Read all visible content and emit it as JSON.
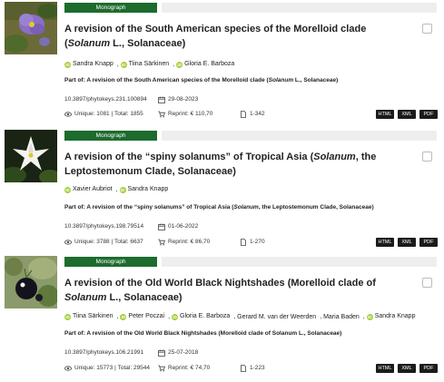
{
  "articles": [
    {
      "type_label": "Monograph",
      "title_pre": "A revision of the South American species of the Morelloid clade (",
      "title_species": "Solanum",
      "title_post": " L., Solanaceae)",
      "authors": [
        "Sandra Knapp",
        "Tiina Särkinen",
        "Gloria E. Barboza"
      ],
      "part_of_prefix": "Part of: ",
      "part_of_pre": "A revision of the South American species of the Morelloid clade (",
      "part_of_species": "Solanum",
      "part_of_post": " L., Solanaceae)",
      "doi": "10.3897/phytokeys.231.100894",
      "date": "29-08-2023",
      "unique": "Unique: 1081",
      "total": "Total: 1855",
      "reprint": "Reprint: € 110,70",
      "pages": "1-342",
      "formats": [
        "HTML",
        "XML",
        "PDF"
      ]
    },
    {
      "type_label": "Monograph",
      "title_pre": "A revision of the “spiny solanums” of Tropical Asia (",
      "title_species": "Solanum",
      "title_post": ", the Leptostemonum Clade, Solanaceae)",
      "authors": [
        "Xavier Aubriot",
        "Sandra Knapp"
      ],
      "part_of_prefix": "Part of: ",
      "part_of_pre": "A revision of the “spiny solanums” of Tropical Asia (",
      "part_of_species": "Solanum",
      "part_of_post": ", the Leptostemonum Clade, Solanaceae)",
      "doi": "10.3897/phytokeys.198.79514",
      "date": "01-06-2022",
      "unique": "Unique: 3788",
      "total": "Total: 6637",
      "reprint": "Reprint: € 86,70",
      "pages": "1-270",
      "formats": [
        "HTML",
        "XML",
        "PDF"
      ]
    },
    {
      "type_label": "Monograph",
      "title_pre": "A revision of the Old World Black Nightshades (Morelloid clade of ",
      "title_species": "Solanum",
      "title_post": " L., Solanaceae)",
      "authors": [
        "Tiina Särkinen",
        "Peter Poczai",
        "Gloria E. Barboza",
        "Gerard M. van der Weerden",
        "Maria Baden",
        "Sandra Knapp"
      ],
      "part_of_prefix": "Part of: ",
      "part_of_pre": "A revision of the Old World Black Nightshades (Morelloid clade of Solanum L., Solanaceae)",
      "part_of_species": "",
      "part_of_post": "",
      "doi": "10.3897/phytokeys.106.21991",
      "date": "25-07-2018",
      "unique": "Unique: 15773",
      "total": "Total: 29544",
      "reprint": "Reprint: € 74,70",
      "pages": "1-223",
      "formats": [
        "HTML",
        "XML",
        "PDF"
      ]
    }
  ],
  "colors": {
    "type_bar": "#1e6b2e",
    "orcid": "#a6ce39",
    "format_button": "#1b1b1b"
  },
  "icons": {
    "views": "eye-icon",
    "date": "calendar-icon",
    "reprint": "cart-icon",
    "pages": "document-icon",
    "orcid": "orcid-icon"
  }
}
